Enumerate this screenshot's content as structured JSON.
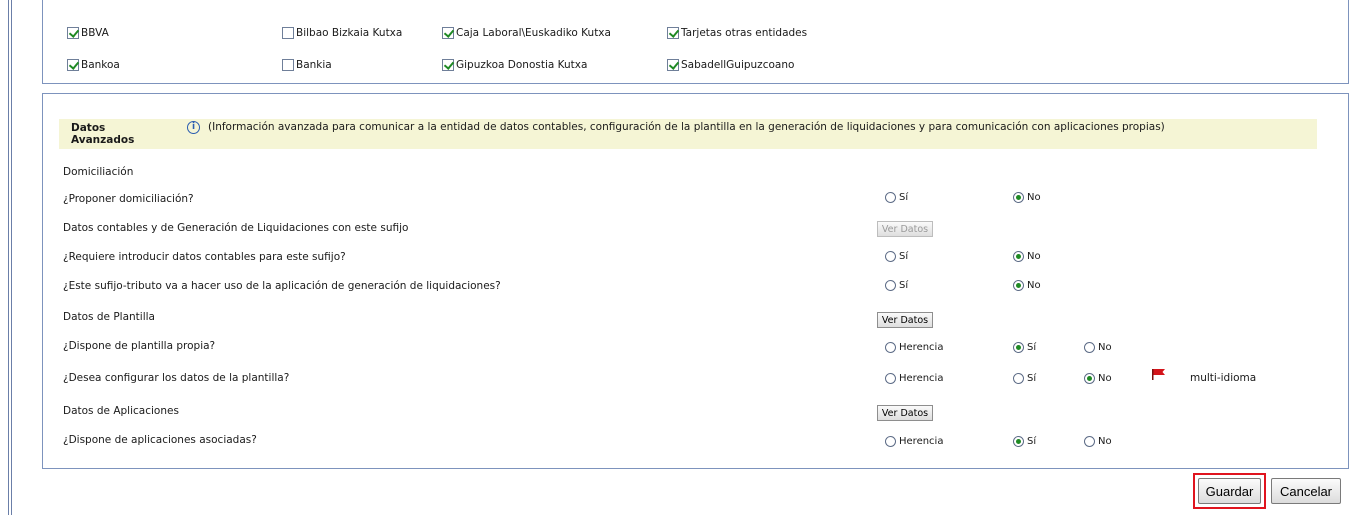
{
  "banks": {
    "row1": [
      {
        "label": "BBVA",
        "checked": true
      },
      {
        "label": "Bilbao Bizkaia Kutxa",
        "checked": false
      },
      {
        "label": "Caja Laboral\\Euskadiko Kutxa",
        "checked": true
      },
      {
        "label": "Tarjetas otras entidades",
        "checked": true
      }
    ],
    "row2": [
      {
        "label": "Bankoa",
        "checked": true
      },
      {
        "label": "Bankia",
        "checked": false
      },
      {
        "label": "Gipuzkoa Donostia Kutxa",
        "checked": true
      },
      {
        "label": "SabadellGuipuzcoano",
        "checked": true
      }
    ]
  },
  "advanced": {
    "title": "Datos Avanzados",
    "info": "(Información avanzada para comunicar a la entidad de datos contables, configuración de la plantilla en la generación de liquidaciones y para comunicación con aplicaciones propias)",
    "sections": {
      "domiciliacion": "Domiciliación",
      "contables": "Datos contables y de Generación de Liquidaciones con este sufijo",
      "plantilla": "Datos de Plantilla",
      "aplicaciones": "Datos de Aplicaciones"
    },
    "questions": {
      "proponer": "¿Proponer domiciliación?",
      "requiere": "¿Requiere introducir datos contables para este sufijo?",
      "sufijo": "¿Este sufijo-tributo va a hacer uso de la aplicación de generación de liquidaciones?",
      "dispone_plantilla": "¿Dispone de plantilla propia?",
      "desea": "¿Desea configurar los datos de la plantilla?",
      "dispone_apps": "¿Dispone de aplicaciones asociadas?"
    },
    "options": {
      "si": "Sí",
      "no": "No",
      "herencia": "Herencia"
    },
    "selected": {
      "proponer": "No",
      "requiere": "No",
      "sufijo": "No",
      "dispone_plantilla": "Sí",
      "desea": "No",
      "dispone_apps": "Sí"
    },
    "ver_datos": "Ver Datos",
    "multi_idioma": "multi-idioma"
  },
  "actions": {
    "guardar": "Guardar",
    "cancelar": "Cancelar"
  },
  "colors": {
    "info_bg": "#f5f5d5",
    "highlight": "#e0141e",
    "check": "#1f8a24",
    "border": "#7d93bd"
  }
}
